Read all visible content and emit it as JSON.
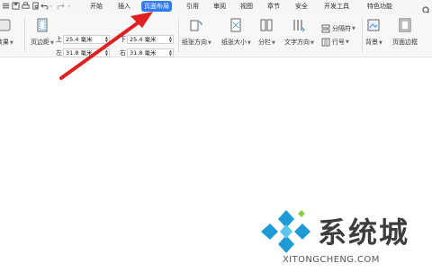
{
  "menubar": {
    "tabs": [
      {
        "label": "开始",
        "active": false
      },
      {
        "label": "插入",
        "active": false
      },
      {
        "label": "页面布局",
        "active": true
      },
      {
        "label": "引用",
        "active": false
      },
      {
        "label": "审阅",
        "active": false
      },
      {
        "label": "视图",
        "active": false
      },
      {
        "label": "章节",
        "active": false
      },
      {
        "label": "安全",
        "active": false
      },
      {
        "label": "开发工具",
        "active": false
      },
      {
        "label": "特色功能",
        "active": false
      }
    ],
    "active_color": "#2f7df6"
  },
  "ribbon": {
    "theme_label": "效果",
    "margins_label": "页边距",
    "margin_top_label": "上",
    "margin_top_value": "25.4 毫米",
    "margin_left_label": "左",
    "margin_left_value": "31.8 毫米",
    "margin_bottom_label": "下",
    "margin_bottom_value": "25.4 毫米",
    "margin_right_label": "右",
    "margin_right_value": "31.8 毫米",
    "orientation_label": "纸张方向",
    "size_label": "纸张大小",
    "columns_label": "分栏",
    "text_direction_label": "文字方向",
    "separator_label": "分隔符",
    "line_number_label": "行号",
    "background_label": "背景",
    "page_border_label": "页面边框"
  },
  "watermark": {
    "title": "系统城",
    "url": "XITONGCHENG.COM",
    "logo_color": "#1e9bd7"
  },
  "annotation": {
    "arrow_color": "#e02020"
  }
}
